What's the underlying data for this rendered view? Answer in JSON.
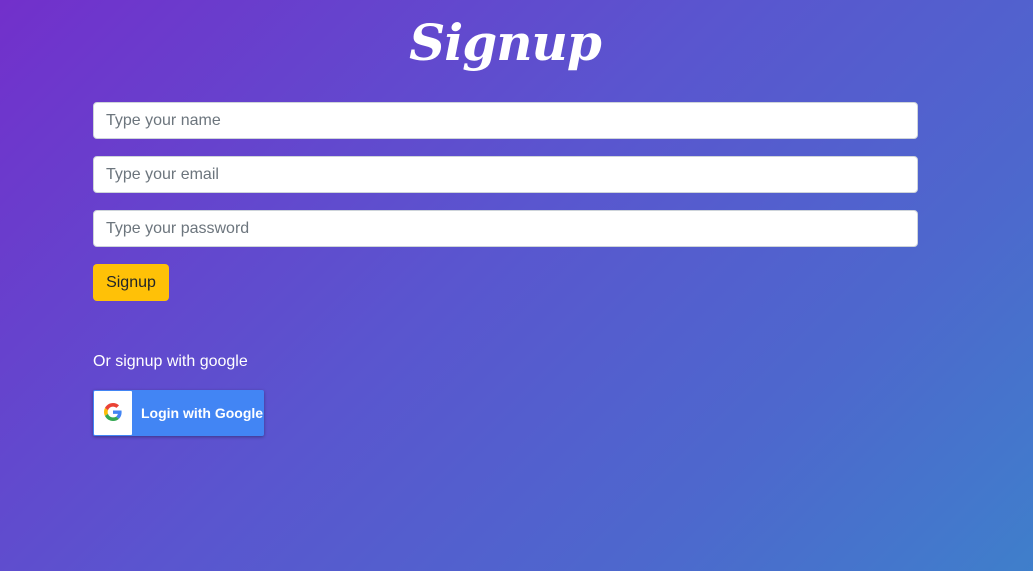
{
  "page": {
    "title": "Signup"
  },
  "form": {
    "name_placeholder": "Type your name",
    "email_placeholder": "Type your email",
    "password_placeholder": "Type your password",
    "submit_label": "Signup"
  },
  "alt_login": {
    "text": "Or signup with google",
    "google_button_label": "Login with Google",
    "google_icon": "google-g-icon"
  },
  "colors": {
    "background_start": "#7230cb",
    "background_end": "#3f7fcb",
    "submit_button": "#ffc107",
    "google_button": "#4285f4"
  }
}
